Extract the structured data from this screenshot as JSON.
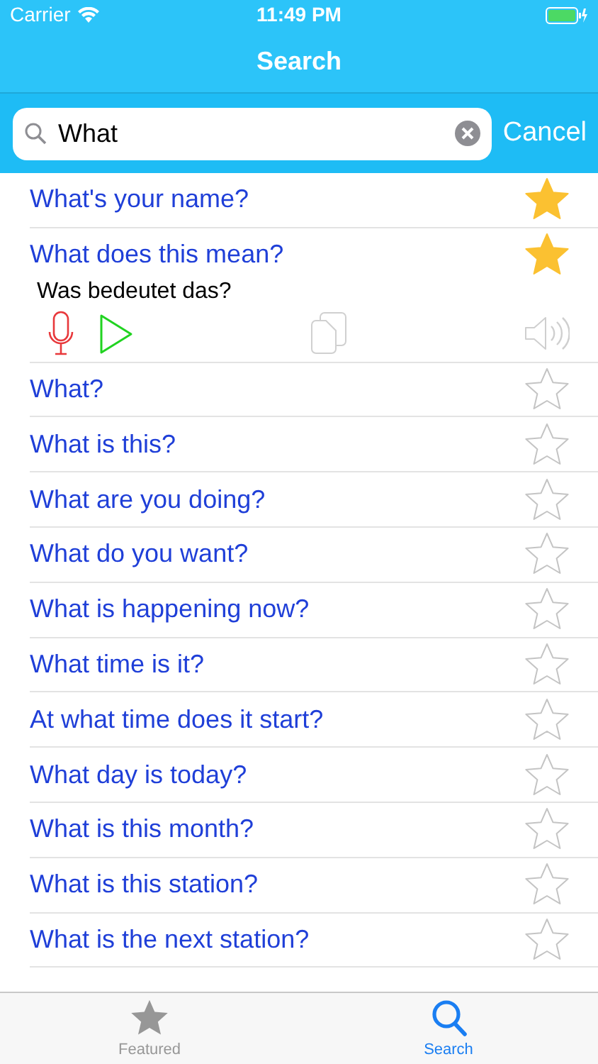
{
  "status_bar": {
    "carrier": "Carrier",
    "time": "11:49 PM"
  },
  "nav": {
    "title": "Search"
  },
  "search": {
    "value": "What",
    "cancel": "Cancel"
  },
  "rows": [
    {
      "text": "What's your name?",
      "starred": true,
      "expanded": false
    },
    {
      "text": "What does this mean?",
      "starred": true,
      "expanded": true,
      "translation": "Was bedeutet das?"
    },
    {
      "text": "What?",
      "starred": false,
      "expanded": false
    },
    {
      "text": "What is this?",
      "starred": false,
      "expanded": false
    },
    {
      "text": "What are you doing?",
      "starred": false,
      "expanded": false
    },
    {
      "text": "What do you want?",
      "starred": false,
      "expanded": false
    },
    {
      "text": "What is happening now?",
      "starred": false,
      "expanded": false
    },
    {
      "text": "What time is it?",
      "starred": false,
      "expanded": false
    },
    {
      "text": "At what time does it start?",
      "starred": false,
      "expanded": false
    },
    {
      "text": "What day is today?",
      "starred": false,
      "expanded": false
    },
    {
      "text": "What is this month?",
      "starred": false,
      "expanded": false
    },
    {
      "text": "What is this station?",
      "starred": false,
      "expanded": false
    },
    {
      "text": "What is the next station?",
      "starred": false,
      "expanded": false
    }
  ],
  "tabs": [
    {
      "label": "Featured",
      "kind": "star",
      "selected": false
    },
    {
      "label": "Search",
      "kind": "search",
      "selected": true
    }
  ]
}
